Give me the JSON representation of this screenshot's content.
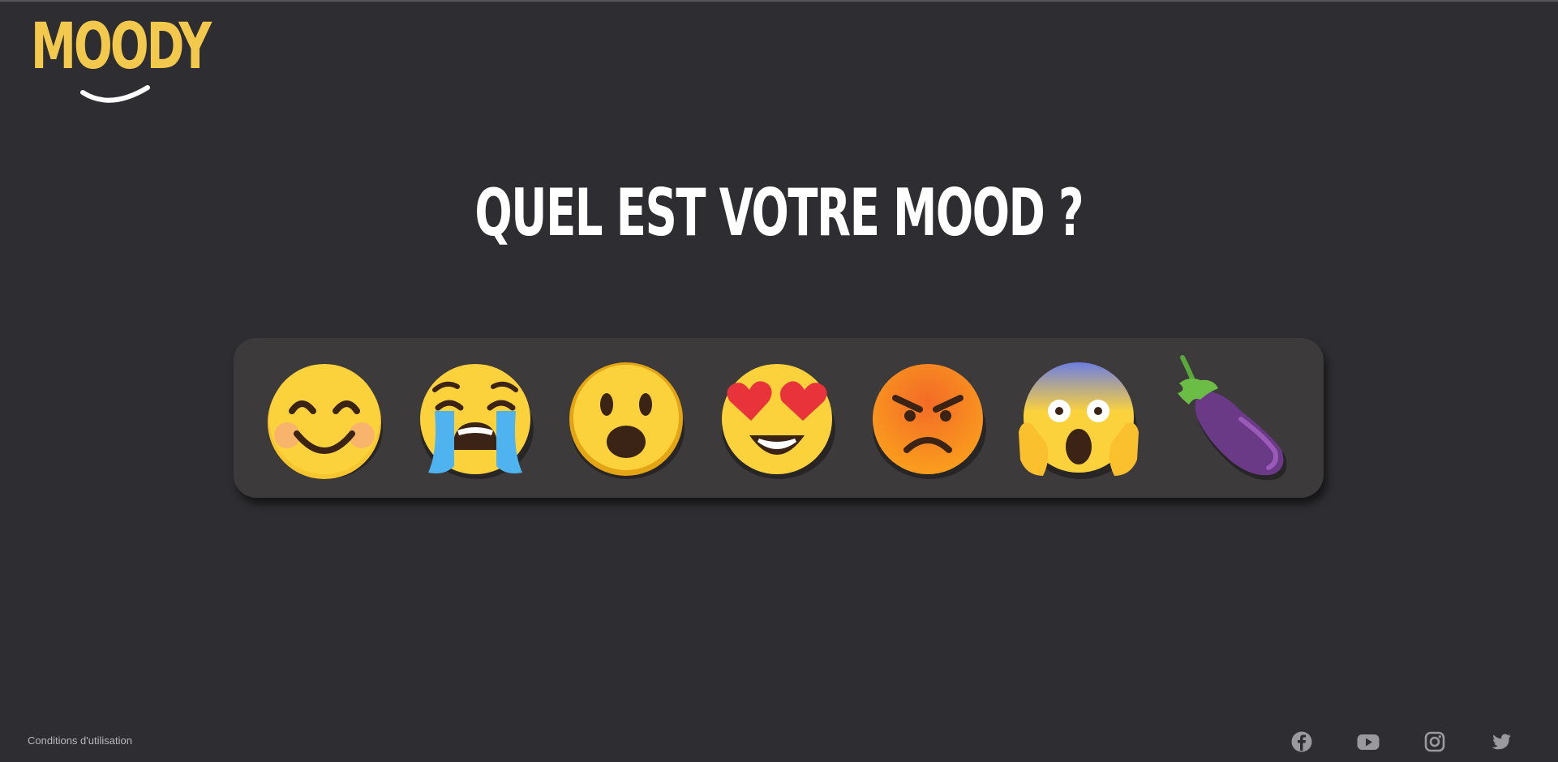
{
  "brand": {
    "logo_text": "MOODY",
    "accent_color": "#f2c94c"
  },
  "main": {
    "headline": "QUEL EST VOTRE MOOD ?"
  },
  "moods": [
    {
      "icon": "smiling-face-icon"
    },
    {
      "icon": "crying-face-icon"
    },
    {
      "icon": "surprised-face-icon"
    },
    {
      "icon": "heart-eyes-face-icon"
    },
    {
      "icon": "angry-face-icon"
    },
    {
      "icon": "screaming-face-icon"
    },
    {
      "icon": "eggplant-icon"
    }
  ],
  "footer": {
    "terms_label": "Conditions d'utilisation",
    "social": [
      {
        "icon": "facebook-icon"
      },
      {
        "icon": "youtube-icon"
      },
      {
        "icon": "instagram-icon"
      },
      {
        "icon": "twitter-icon"
      }
    ]
  }
}
